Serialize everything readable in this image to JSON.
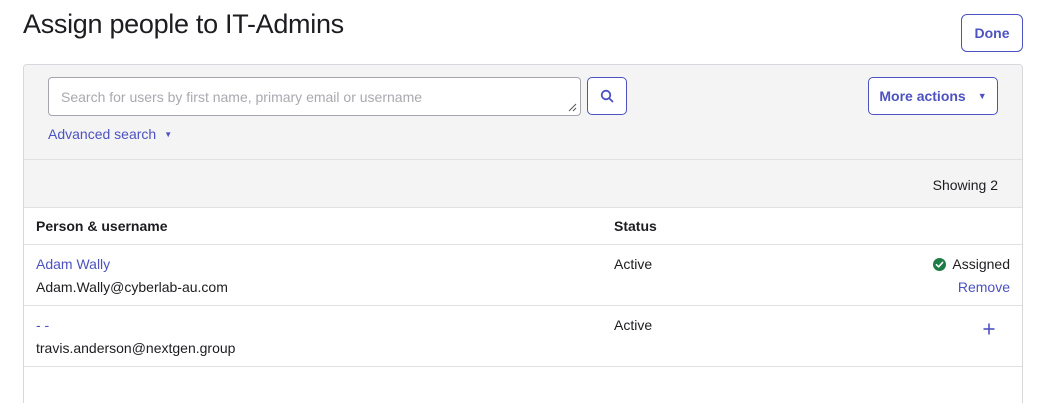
{
  "page": {
    "title": "Assign people to IT-Admins",
    "done_label": "Done"
  },
  "search": {
    "placeholder": "Search for users by first name, primary email or username",
    "advanced_label": "Advanced search",
    "search_icon": "search-icon"
  },
  "actions": {
    "more_label": "More actions"
  },
  "list": {
    "showing": "Showing 2",
    "columns": {
      "person": "Person & username",
      "status": "Status"
    },
    "rows": [
      {
        "name": "Adam Wally",
        "email": "Adam.Wally@cyberlab-au.com",
        "status": "Active",
        "assigned_label": "Assigned",
        "remove_label": "Remove"
      },
      {
        "name": "- -",
        "email": "travis.anderson@nextgen.group",
        "status": "Active",
        "add_icon": "plus-icon"
      }
    ]
  },
  "colors": {
    "accent": "#4c52c1",
    "success": "#1e7c45",
    "toolbar_bg": "#f4f4f4"
  }
}
